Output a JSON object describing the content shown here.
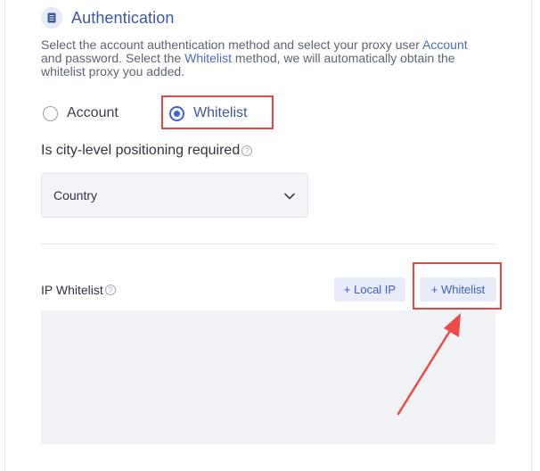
{
  "section": {
    "title": "Authentication",
    "icon": "document-icon"
  },
  "description": {
    "part1": "Select the account authentication method and select your proxy user ",
    "link1": "Account",
    "part2": " and password. Select the ",
    "link2": "Whitelist",
    "part3": " method, we will automatically obtain the whitelist proxy you added."
  },
  "auth_method": {
    "options": [
      {
        "label": "Account",
        "selected": false
      },
      {
        "label": "Whitelist",
        "selected": true
      }
    ]
  },
  "city_question": {
    "label": "Is city-level positioning required",
    "help": "?"
  },
  "location_select": {
    "value": "Country"
  },
  "ip_whitelist": {
    "label": "IP Whitelist",
    "help": "?",
    "local_ip_button": "+ Local IP",
    "add_whitelist_button": "+ Whitelist",
    "text": ""
  },
  "colors": {
    "accent": "#3e63d6",
    "callout": "#e84545",
    "button_bg": "#e7ecf8"
  }
}
